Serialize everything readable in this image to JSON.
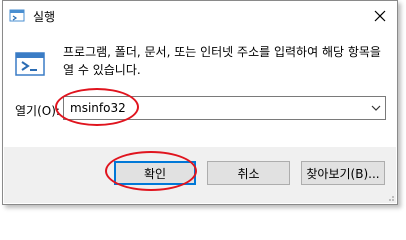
{
  "window": {
    "title": "실행",
    "close_icon": "close-icon",
    "app_icon": "run-app-icon"
  },
  "dialog": {
    "description": "프로그램, 폴더, 문서, 또는 인터넷 주소를 입력하여 해당 항목을 열 수 있습니다.",
    "open_label": "열기(O):",
    "open_value": "msinfo32"
  },
  "buttons": {
    "ok": "확인",
    "cancel": "취소",
    "browse": "찾아보기(B)..."
  },
  "colors": {
    "highlight": "#e0141e",
    "focus": "#0078d7"
  }
}
